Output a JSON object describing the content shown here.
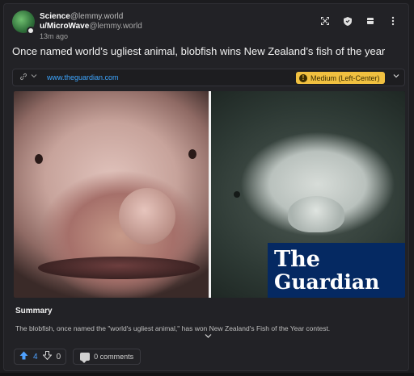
{
  "post": {
    "community_name": "Science",
    "community_host": "@lemmy.world",
    "user_name": "u/MicroWave",
    "user_host": "@lemmy.world",
    "time_ago": "13m ago",
    "title": "Once named world’s ugliest animal, blobfish wins New Zealand’s fish of the year"
  },
  "header_icons": [
    {
      "name": "fullscreen-icon",
      "glyph": "⤢"
    },
    {
      "name": "shield-icon",
      "glyph": "⛨"
    },
    {
      "name": "bookmark-icon",
      "glyph": "⬛"
    },
    {
      "name": "more-icon",
      "glyph": "⋮"
    }
  ],
  "link": {
    "url": "www.theguardian.com",
    "bias_label": "Medium (Left-Center)",
    "bias_icon": "!",
    "bias_color": "#f0c040"
  },
  "image": {
    "logo_line1": "The",
    "logo_line2": "Guardian"
  },
  "summary": {
    "heading": "Summary",
    "text": "The blobfish, once named the \"world's ugliest animal,\" has won New Zealand's Fish of the Year contest."
  },
  "footer": {
    "upvotes": "4",
    "downvotes": "0",
    "comments_label": "0 comments"
  },
  "colors": {
    "accent": "#4ea1ff",
    "link": "#3ea6ff",
    "guardian_blue": "#052962",
    "background": "#222226"
  }
}
